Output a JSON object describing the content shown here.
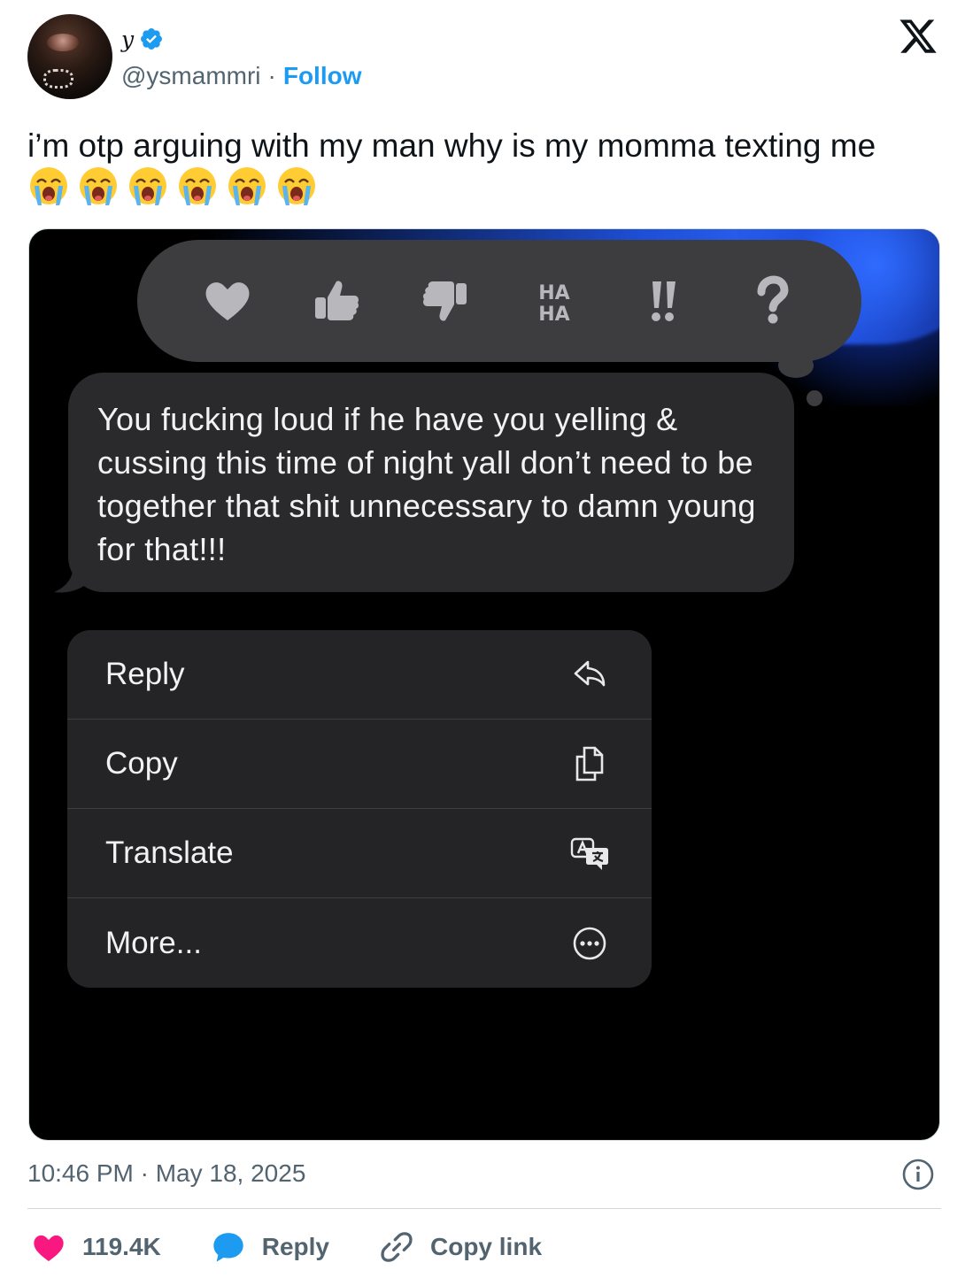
{
  "author": {
    "display_name": "y",
    "handle": "@ysmammri",
    "separator": "·",
    "follow_label": "Follow"
  },
  "tweet": {
    "text": "i’m otp arguing with my man why is my momma texting me",
    "emoji": [
      "loudly-crying-face",
      "loudly-crying-face",
      "loudly-crying-face",
      "loudly-crying-face",
      "loudly-crying-face",
      "loudly-crying-face"
    ]
  },
  "media": {
    "reactions": [
      "heart-icon",
      "thumbs-up-icon",
      "thumbs-down-icon",
      "haha-icon",
      "double-exclamation-icon",
      "question-icon"
    ],
    "haha_text": [
      "HA",
      "HA"
    ],
    "message": "You fucking loud if he have you yelling & cussing this time of night yall don’t need to be together that shit unnecessary to damn young for that!!!",
    "menu": [
      {
        "label": "Reply",
        "icon": "reply-arrow-icon"
      },
      {
        "label": "Copy",
        "icon": "copy-icon"
      },
      {
        "label": "Translate",
        "icon": "translate-icon"
      },
      {
        "label": "More...",
        "icon": "more-circle-icon"
      }
    ]
  },
  "meta": {
    "timestamp": "10:46 PM · May 18, 2025"
  },
  "actions": {
    "likes": "119.4K",
    "reply_label": "Reply",
    "copy_link_label": "Copy link"
  },
  "colors": {
    "accent": "#1d9bf0",
    "like": "#f91880",
    "muted": "#536471",
    "bubble": "#2a2a2d",
    "menu": "#242426"
  }
}
